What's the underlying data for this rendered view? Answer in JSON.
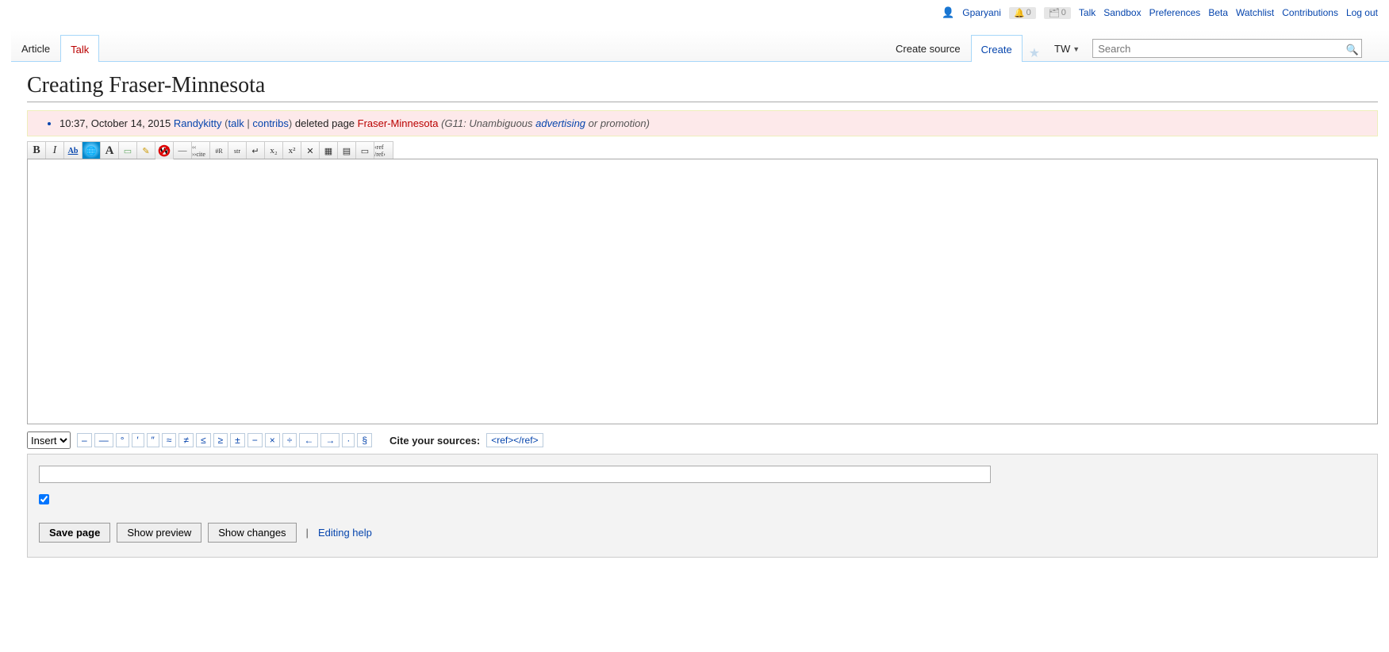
{
  "personal": {
    "username": "Gparyani",
    "badge1": "0",
    "badge2": "0",
    "links": [
      "Talk",
      "Sandbox",
      "Preferences",
      "Beta",
      "Watchlist",
      "Contributions",
      "Log out"
    ]
  },
  "tabs_left": [
    {
      "label": "Article",
      "kind": "plain",
      "active": false
    },
    {
      "label": "Talk",
      "kind": "talk",
      "active": true
    }
  ],
  "tabs_right": [
    {
      "label": "Create source",
      "kind": "plain",
      "active": false
    },
    {
      "label": "Create",
      "kind": "blue",
      "active": true
    }
  ],
  "tw_label": "TW",
  "search": {
    "placeholder": "Search"
  },
  "heading": "Creating Fraser-Minnesota",
  "log": {
    "timestamp": "10:37, October 14, 2015",
    "user": "Randykitty",
    "talk": "talk",
    "contribs": "contribs",
    "action": " deleted page ",
    "page": "Fraser-Minnesota",
    "reason_prefix": "G11: Unambiguous ",
    "reason_link": "advertising",
    "reason_suffix": " or promotion"
  },
  "toolbar": [
    {
      "name": "bold",
      "title": "Bold",
      "glyph": "B"
    },
    {
      "name": "italic",
      "title": "Italic",
      "glyph": "I"
    },
    {
      "name": "underline",
      "title": "Underline",
      "glyph": "Ab"
    },
    {
      "name": "globe",
      "title": "External link",
      "glyph": "🌐"
    },
    {
      "name": "bigA",
      "title": "Headline",
      "glyph": "A"
    },
    {
      "name": "pic",
      "title": "Embedded file",
      "glyph": "▭"
    },
    {
      "name": "pencil",
      "title": "Signature",
      "glyph": "✎"
    },
    {
      "name": "nowiki",
      "title": "Nowiki",
      "glyph": "W"
    },
    {
      "name": "hr",
      "title": "Horizontal line",
      "glyph": "—"
    },
    {
      "name": "cite",
      "title": "Cite",
      "glyph": "‹‹ ››cite"
    },
    {
      "name": "redirect",
      "title": "Redirect",
      "glyph": "#R"
    },
    {
      "name": "strike",
      "title": "Strikethrough",
      "glyph": "str"
    },
    {
      "name": "break",
      "title": "Line break",
      "glyph": "↵"
    },
    {
      "name": "sub",
      "title": "Subscript",
      "glyph": "x₂"
    },
    {
      "name": "sup",
      "title": "Superscript",
      "glyph": "x²"
    },
    {
      "name": "hidden",
      "title": "Hidden comment",
      "glyph": "✕"
    },
    {
      "name": "gallery",
      "title": "Gallery",
      "glyph": "▦"
    },
    {
      "name": "table",
      "title": "Table",
      "glyph": "▤"
    },
    {
      "name": "block",
      "title": "Blockquote",
      "glyph": "▭"
    },
    {
      "name": "ref",
      "title": "Reference",
      "glyph": "‹ref /ref›"
    }
  ],
  "insert": {
    "select_value": "Insert",
    "chars": [
      "–",
      "—",
      "°",
      "′",
      "″",
      "≈",
      "≠",
      "≤",
      "≥",
      "±",
      "−",
      "×",
      "÷",
      "←",
      "→",
      "·",
      "§"
    ],
    "cite_label": "Cite your sources:",
    "ref_tag": "<ref></ref>"
  },
  "buttons": {
    "save": "Save page",
    "preview": "Show preview",
    "changes": "Show changes",
    "help": "Editing help"
  }
}
